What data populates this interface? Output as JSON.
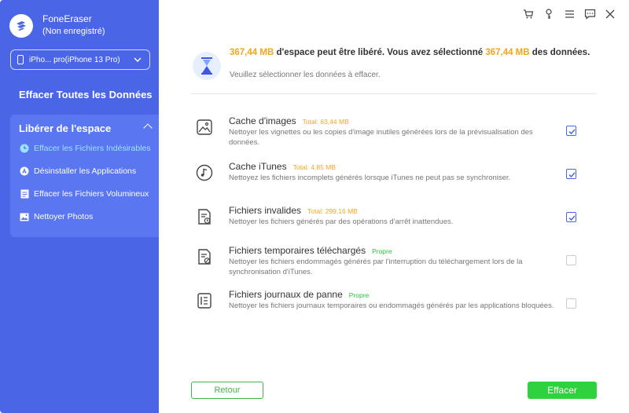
{
  "app": {
    "name": "FoneEraser",
    "status": "(Non enregistré)"
  },
  "device": {
    "label": "iPho... pro(iPhone 13 Pro)"
  },
  "sidebar": {
    "erase_all": "Effacer Toutes les Données",
    "free_space": "Libérer de l'espace",
    "items": [
      {
        "label": "Effacer les Fichiers Indésirables",
        "icon": "clock-icon",
        "active": true
      },
      {
        "label": "Désinstaller les Applications",
        "icon": "app-store-icon",
        "active": false
      },
      {
        "label": "Effacer les Fichiers Volumineux",
        "icon": "file-icon",
        "active": false
      },
      {
        "label": "Nettoyer Photos",
        "icon": "photo-icon",
        "active": false
      }
    ]
  },
  "titlebar": [
    "cart-icon",
    "key-icon",
    "menu-icon",
    "feedback-icon",
    "close-icon"
  ],
  "summary": {
    "amount1": "367,44 MB",
    "text1": " d'espace peut être libéré. Vous avez sélectionné ",
    "amount2": "367,44 MB",
    "text2": " des données.",
    "hint": "Veuillez sélectionner les données à effacer."
  },
  "items": [
    {
      "title": "Cache d'images",
      "badge": "Total: 63,44 MB",
      "badge_type": "total",
      "desc": "Nettoyer les vignettes ou les copies d'image inutiles générées lors de la prévisualisation des données.",
      "checked": true,
      "icon": "image-icon"
    },
    {
      "title": "Cache iTunes",
      "badge": "Total: 4,85 MB",
      "badge_type": "total",
      "desc": "Nettoyez les fichiers incomplets générés lorsque iTunes ne peut pas se synchroniser.",
      "checked": true,
      "icon": "music-note-icon"
    },
    {
      "title": "Fichiers invalides",
      "badge": "Total: 299,16 MB",
      "badge_type": "total",
      "desc": "Nettoyer les fichiers générés par des opérations d'arrêt inattendues.",
      "checked": true,
      "icon": "invalid-file-icon"
    },
    {
      "title": "Fichiers temporaires téléchargés",
      "badge": "Propre",
      "badge_type": "clean",
      "desc": "Nettoyer les fichiers endommagés générés par l'interruption du téléchargement lors de la synchronisation d'iTunes.",
      "checked": false,
      "icon": "temp-file-icon"
    },
    {
      "title": "Fichiers journaux de panne",
      "badge": "Propre",
      "badge_type": "clean",
      "desc": "Nettoyer les fichiers journaux temporaires ou endommagés générés par les applications bloquées.",
      "checked": false,
      "icon": "log-file-icon"
    }
  ],
  "buttons": {
    "back": "Retour",
    "erase": "Effacer"
  },
  "colors": {
    "sidebar": "#4a66e6",
    "accent_orange": "#f2a51d",
    "accent_green": "#2ed13e"
  }
}
